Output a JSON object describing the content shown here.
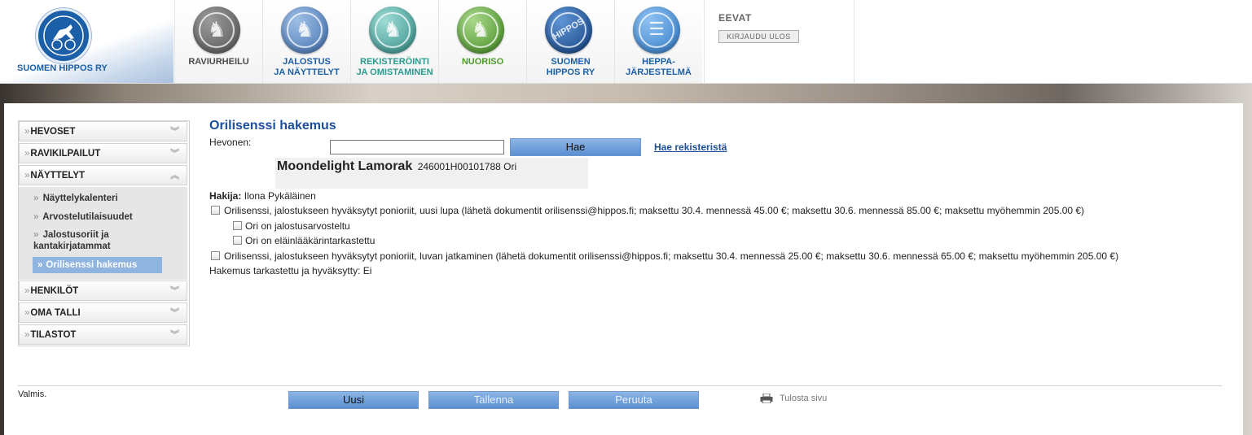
{
  "header": {
    "logo_text": "SUOMEN HIPPOS RY",
    "nav": [
      {
        "label": "RAVIURHEILU",
        "color": "#6a6a6a",
        "icon": "horse-head-icon",
        "text_color": "#4a4a4a"
      },
      {
        "label": "JALOSTUS\nJA NÄYTTELYT",
        "color": "#5b87bd",
        "icon": "horse-head-icon",
        "text_color": "#1b5fa8"
      },
      {
        "label": "REKISTERÖINTI\nJA OMISTAMINEN",
        "color": "#4aa6a0",
        "icon": "horse-head-icon",
        "text_color": "#2c9a8f"
      },
      {
        "label": "NUORISO",
        "color": "#63a33c",
        "icon": "horse-head-icon",
        "text_color": "#4f9a2c"
      },
      {
        "label": "SUOMEN\nHIPPOS RY",
        "color": "#1e5ca8",
        "icon": "hippos-icon",
        "text_color": "#1b5fa8"
      },
      {
        "label": "HEPPA-\nJÄRJESTELMÄ",
        "color": "#3c8ad6",
        "icon": "document-icon",
        "text_color": "#1b5fa8"
      }
    ],
    "user_name": "EEVAT",
    "logout_label": "KIRJAUDU ULOS"
  },
  "sidebar": {
    "sections": [
      {
        "label": "HEVOSET",
        "expanded": false
      },
      {
        "label": "RAVIKILPAILUT",
        "expanded": false
      },
      {
        "label": "NÄYTTELYT",
        "expanded": true
      },
      {
        "label": "HENKILÖT",
        "expanded": false
      },
      {
        "label": "OMA TALLI",
        "expanded": false
      },
      {
        "label": "TILASTOT",
        "expanded": false
      }
    ],
    "sub_items": [
      "Näyttelykalenteri",
      "Arvostelutilaisuudet",
      "Jalostusoriit ja\nkantakirjatammat"
    ],
    "active_item": "Orilisenssi hakemus"
  },
  "form": {
    "title": "Orilisenssi hakemus",
    "horse_label": "Hevonen:",
    "horse_input_value": "",
    "search_button": "Hae",
    "registry_link": "Hae rekisteristä",
    "horse_name": "Moondelight Lamorak",
    "horse_id": "246001H00101788 Ori",
    "applicant_label": "Hakija:",
    "applicant_name": "Ilona Pykäläinen",
    "option1": "Orilisenssi, jalostukseen hyväksytyt ponioriit, uusi lupa (lähetä dokumentit orilisenssi@hippos.fi; maksettu 30.4. mennessä 45.00 €; maksettu 30.6. mennessä 85.00 €; maksettu myöhemmin 205.00 €)",
    "sub_option1": "Ori on jalostusarvosteltu",
    "sub_option2": "Ori on eläinlääkärintarkastettu",
    "option2": "Orilisenssi, jalostukseen hyväksytyt ponioriit, luvan jatkaminen (lähetä dokumentit orilisenssi@hippos.fi; maksettu 30.4. mennessä 25.00 €; maksettu 30.6. mennessä 65.00 €; maksettu myöhemmin 205.00 €)",
    "approved_line": "Hakemus tarkastettu ja hyväksytty: Ei"
  },
  "footer": {
    "status": "Valmis.",
    "buttons": [
      "Uusi",
      "Tallenna",
      "Peruuta"
    ],
    "print_label": "Tulosta sivu"
  }
}
